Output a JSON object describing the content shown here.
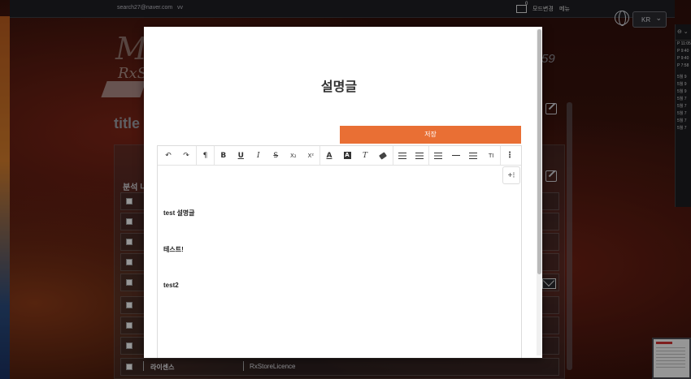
{
  "topbar": {
    "email": "search27@naver.com",
    "user_short": "vv",
    "mail_count": "0",
    "mode_label": "모드변경",
    "menu_label": "메뉴",
    "lang_value": "KR"
  },
  "background": {
    "page_number_hint": "59",
    "title_fragment": "title",
    "section_label": "분석 니",
    "last_row_label": "라이센스",
    "last_row_value": "RxStoreLicence"
  },
  "right_panel": {
    "lines": [
      "P 11:05",
      "P 9:40",
      "P 9:40",
      "P 7:58",
      "5월 9",
      "5월 9",
      "5월 9",
      "5월 7",
      "5월 7",
      "5월 7",
      "5월 7",
      "5월 7"
    ]
  },
  "modal": {
    "title": "설명글",
    "save_label": "저장",
    "toolbar": {
      "undo": "↶",
      "redo": "↷",
      "paragraph": "¶",
      "bold": "B",
      "underline": "U",
      "italic": "I",
      "strike": "S",
      "subscript": "X₂",
      "superscript": "X²",
      "font_color": "A",
      "bg_color": "A",
      "clear_format": "T",
      "text_size": "TI",
      "add_block": "+⁝"
    },
    "content": [
      "test 설명글",
      "테스트!",
      "test2"
    ]
  },
  "icons": {
    "globe": "globe-icon",
    "mail": "mail-icon",
    "edit": "edit-icon",
    "envelope": "envelope-icon"
  }
}
